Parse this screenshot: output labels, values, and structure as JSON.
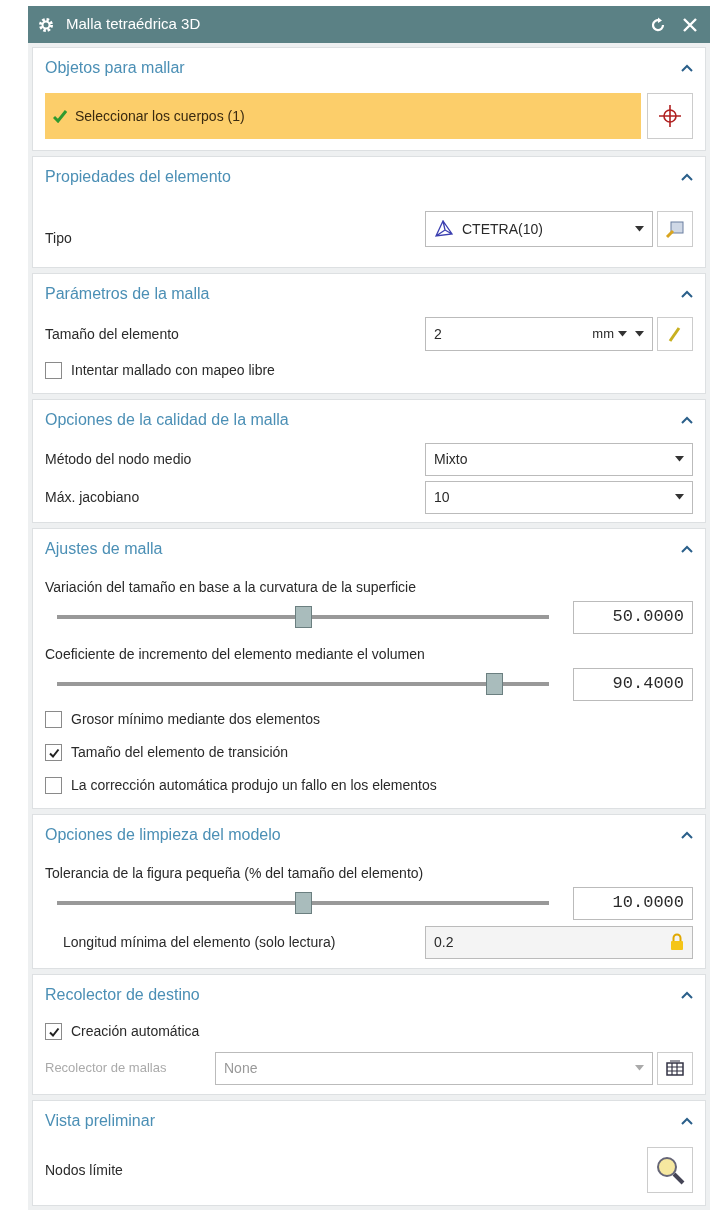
{
  "window": {
    "title": "Malla tetraédrica 3D"
  },
  "sections": [
    {
      "title": "Objetos para mallar",
      "expanded": true,
      "rows": [
        {
          "kind": "selection",
          "label": "Seleccionar los cuerpos (1)",
          "checked": true
        }
      ]
    },
    {
      "title": "Propiedades del elemento",
      "expanded": true,
      "rows": [
        {
          "kind": "element_type",
          "label": "Tipo",
          "value": "CTETRA(10)"
        }
      ]
    },
    {
      "title": "Parámetros de la malla",
      "expanded": true,
      "rows": [
        {
          "kind": "unit_field",
          "label": "Tamaño del elemento",
          "value": "2",
          "unit": "mm"
        },
        {
          "kind": "checkbox",
          "label": "Intentar mallado con mapeo libre",
          "checked": false
        }
      ]
    },
    {
      "title": "Opciones de la calidad de la malla",
      "expanded": true,
      "rows": [
        {
          "kind": "select",
          "label": "Método del nodo medio",
          "value": "Mixto"
        },
        {
          "kind": "select",
          "label": "Máx. jacobiano",
          "value": "10"
        }
      ]
    },
    {
      "title": "Ajustes de malla",
      "expanded": true,
      "rows": [
        {
          "kind": "slider",
          "label": "Variación del tamaño en base a la curvatura de la superficie",
          "level": 0.5,
          "reading": "50.0000"
        },
        {
          "kind": "slider",
          "label": "Coeficiente de incremento del elemento mediante el volumen",
          "level": 0.904,
          "reading": "90.4000"
        },
        {
          "kind": "checkbox",
          "label": "Grosor mínimo mediante dos elementos",
          "checked": false
        },
        {
          "kind": "checkbox",
          "label": "Tamaño del elemento de transición",
          "checked": true
        },
        {
          "kind": "checkbox",
          "label": "La corrección automática produjo un fallo en los elementos",
          "checked": false
        }
      ]
    },
    {
      "title": "Opciones de limpieza del modelo",
      "expanded": true,
      "rows": [
        {
          "kind": "slider",
          "label": "Tolerancia de la figura pequeña (% del tamaño del elemento)",
          "level": 0.5,
          "reading": "10.0000"
        },
        {
          "kind": "readonly",
          "label": "Longitud mínima del elemento (solo lectura)",
          "value": "0.2"
        }
      ]
    },
    {
      "title": "Recolector de destino",
      "expanded": true,
      "rows": [
        {
          "kind": "checkbox",
          "label": "Creación automática",
          "checked": true
        },
        {
          "kind": "collector",
          "label": "Recolector de mallas",
          "value": "None",
          "disabled": true
        }
      ]
    },
    {
      "title": "Vista preliminar",
      "expanded": true,
      "rows": [
        {
          "kind": "preview",
          "label": "Nodos límite"
        }
      ]
    }
  ]
}
